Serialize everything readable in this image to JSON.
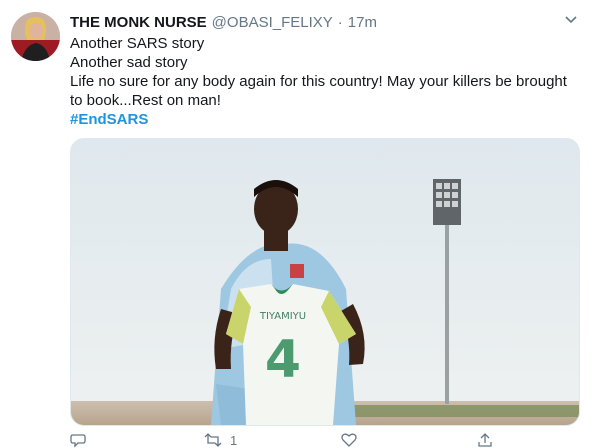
{
  "tweet": {
    "author_name": "THE MONK NURSE",
    "handle": "@OBASI_FELIXY",
    "separator": "·",
    "time": "17m",
    "lines": [
      "Another SARS story",
      "Another sad story",
      "Life no sure for any body again for this country! May your killers be brought to book...Rest on man!"
    ],
    "hashtag": "#EndSARS",
    "jersey_name": "TIYAMIYU",
    "jersey_number": "4",
    "retweet_count": "1"
  },
  "colors": {
    "link": "#1b95e0",
    "muted": "#657786",
    "sky": "#dfe8ee"
  },
  "icons": [
    "caret-down-icon",
    "reply-icon",
    "retweet-icon",
    "like-icon",
    "share-icon"
  ]
}
